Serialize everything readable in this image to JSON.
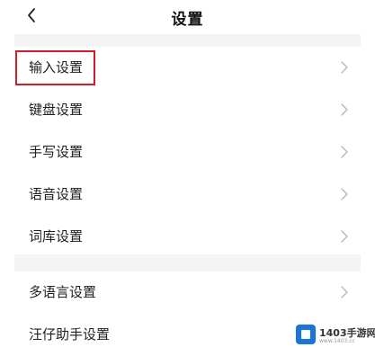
{
  "header": {
    "back_icon": "chevron-left-icon",
    "title": "设置"
  },
  "settings_group_1": [
    {
      "label": "输入设置",
      "highlighted": true
    },
    {
      "label": "键盘设置"
    },
    {
      "label": "手写设置"
    },
    {
      "label": "语音设置"
    },
    {
      "label": "词库设置"
    }
  ],
  "settings_group_2": [
    {
      "label": "多语言设置"
    },
    {
      "label": "汪仔助手设置"
    }
  ],
  "watermark": {
    "text": "1403手游网",
    "sub": "www.1403.cc"
  },
  "colors": {
    "highlight_border": "#d11d2a",
    "section_gap": "#f4f4f5"
  }
}
